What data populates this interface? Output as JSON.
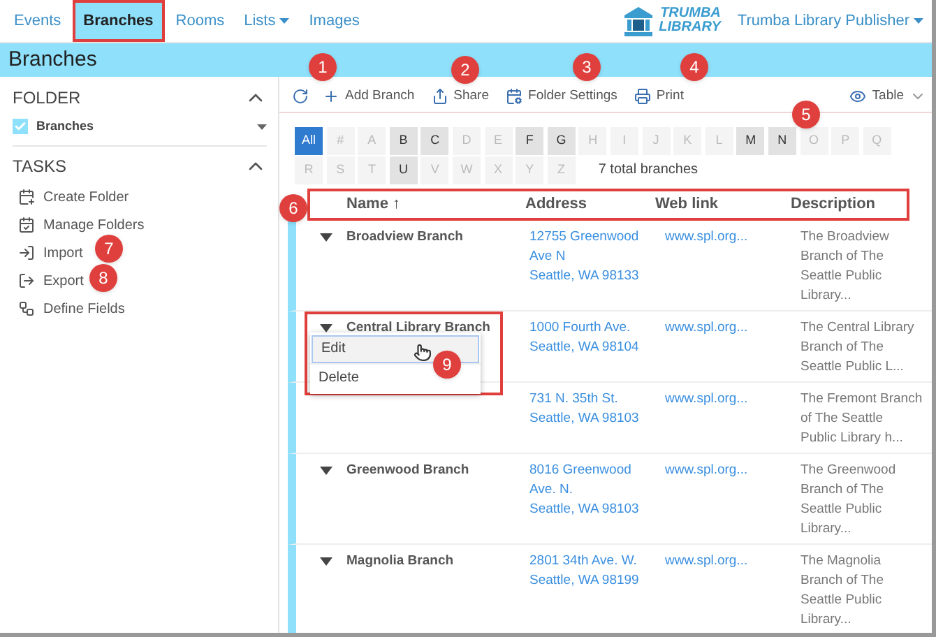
{
  "nav": {
    "tabs": [
      {
        "label": "Events",
        "selected": false,
        "dropdown": false
      },
      {
        "label": "Branches",
        "selected": true,
        "dropdown": false
      },
      {
        "label": "Rooms",
        "selected": false,
        "dropdown": false
      },
      {
        "label": "Lists",
        "selected": false,
        "dropdown": true
      },
      {
        "label": "Images",
        "selected": false,
        "dropdown": false
      }
    ],
    "logo": [
      "TRUMBA",
      "LIBRARY"
    ],
    "account": "Trumba Library Publisher"
  },
  "title": "Branches",
  "sidebar": {
    "folder_heading": "FOLDER",
    "folder": {
      "label": "Branches",
      "checked": true
    },
    "tasks_heading": "TASKS",
    "tasks": [
      {
        "kind": "create",
        "label": "Create Folder"
      },
      {
        "kind": "manage",
        "label": "Manage Folders"
      },
      {
        "kind": "import",
        "label": "Import"
      },
      {
        "kind": "export",
        "label": "Export"
      },
      {
        "kind": "fields",
        "label": "Define Fields"
      }
    ]
  },
  "toolbar": {
    "actions": [
      {
        "kind": "add",
        "label": "Add Branch"
      },
      {
        "kind": "share",
        "label": "Share"
      },
      {
        "kind": "settings",
        "label": "Folder Settings"
      },
      {
        "kind": "print",
        "label": "Print"
      }
    ],
    "view": "Table"
  },
  "letters": [
    {
      "label": "All",
      "selected": true,
      "has_items": true
    },
    {
      "label": "#",
      "selected": false,
      "has_items": false
    },
    {
      "label": "A",
      "selected": false,
      "has_items": false
    },
    {
      "label": "B",
      "selected": false,
      "has_items": true
    },
    {
      "label": "C",
      "selected": false,
      "has_items": true
    },
    {
      "label": "D",
      "selected": false,
      "has_items": false
    },
    {
      "label": "E",
      "selected": false,
      "has_items": false
    },
    {
      "label": "F",
      "selected": false,
      "has_items": true
    },
    {
      "label": "G",
      "selected": false,
      "has_items": true
    },
    {
      "label": "H",
      "selected": false,
      "has_items": false
    },
    {
      "label": "I",
      "selected": false,
      "has_items": false
    },
    {
      "label": "J",
      "selected": false,
      "has_items": false
    },
    {
      "label": "K",
      "selected": false,
      "has_items": false
    },
    {
      "label": "L",
      "selected": false,
      "has_items": false
    },
    {
      "label": "M",
      "selected": false,
      "has_items": true
    },
    {
      "label": "N",
      "selected": false,
      "has_items": true
    },
    {
      "label": "O",
      "selected": false,
      "has_items": false
    },
    {
      "label": "P",
      "selected": false,
      "has_items": false
    },
    {
      "label": "Q",
      "selected": false,
      "has_items": false
    },
    {
      "label": "R",
      "selected": false,
      "has_items": false
    },
    {
      "label": "S",
      "selected": false,
      "has_items": false
    },
    {
      "label": "T",
      "selected": false,
      "has_items": false
    },
    {
      "label": "U",
      "selected": false,
      "has_items": true
    },
    {
      "label": "V",
      "selected": false,
      "has_items": false
    },
    {
      "label": "W",
      "selected": false,
      "has_items": false
    },
    {
      "label": "X",
      "selected": false,
      "has_items": false
    },
    {
      "label": "Y",
      "selected": false,
      "has_items": false
    },
    {
      "label": "Z",
      "selected": false,
      "has_items": false
    }
  ],
  "total": "7 total branches",
  "table": {
    "columns": [
      "Name ↑",
      "Address",
      "Web link",
      "Description"
    ],
    "rows": [
      {
        "name": "Broadview Branch",
        "address": [
          "12755 Greenwood",
          "Ave N",
          "Seattle, WA 98133"
        ],
        "web_link": "www.spl.org...",
        "description": [
          "The Broadview",
          "Branch of The",
          "Seattle Public",
          "Library..."
        ]
      },
      {
        "name": "Central Library Branch",
        "address": [
          "1000 Fourth Ave.",
          "Seattle, WA 98104"
        ],
        "web_link": "www.spl.org...",
        "description": [
          "The Central Library",
          "Branch of The",
          "Seattle Public L..."
        ],
        "menu": [
          "Edit",
          "Delete"
        ]
      },
      {
        "address": [
          "731 N. 35th St.",
          "Seattle, WA 98103"
        ],
        "web_link": "www.spl.org...",
        "description": [
          "The Fremont Branch",
          "of The Seattle",
          "Public Library h..."
        ]
      },
      {
        "name": "Greenwood Branch",
        "address": [
          "8016 Greenwood",
          "Ave. N.",
          "Seattle, WA 98103"
        ],
        "web_link": "www.spl.org...",
        "description": [
          "The Greenwood",
          "Branch of The",
          "Seattle Public",
          "Library..."
        ]
      },
      {
        "name": "Magnolia Branch",
        "address": [
          "2801 34th Ave. W.",
          "Seattle, WA 98199"
        ],
        "web_link": "www.spl.org...",
        "description": [
          "The Magnolia",
          "Branch of The",
          "Seattle Public",
          "Library..."
        ]
      }
    ]
  },
  "callouts": [
    "1",
    "2",
    "3",
    "4",
    "5",
    "6",
    "7",
    "8",
    "9"
  ]
}
